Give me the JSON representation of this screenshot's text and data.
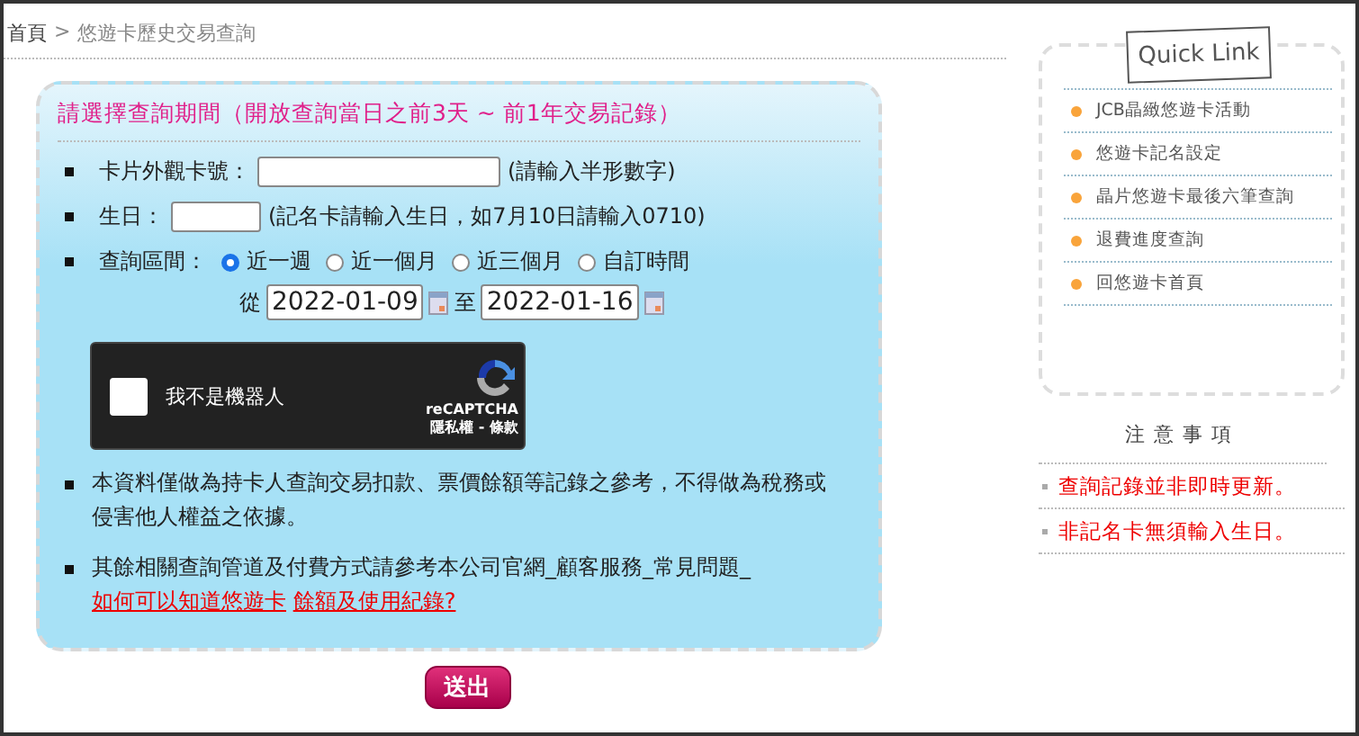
{
  "breadcrumb": {
    "home": "首頁",
    "separator": ">",
    "current": "悠遊卡歷史交易查詢"
  },
  "query_panel": {
    "heading": "請選擇查詢期間（開放查詢當日之前3天 ~ 前1年交易記錄）",
    "card_number": {
      "label": "卡片外觀卡號：",
      "hint": "(請輸入半形數字)"
    },
    "birthday": {
      "label": "生日：",
      "hint": "(記名卡請輸入生日，如7月10日請輸入0710)"
    },
    "period": {
      "label": "查詢區間：",
      "options": [
        {
          "label": "近一週",
          "selected": true
        },
        {
          "label": "近一個月",
          "selected": false
        },
        {
          "label": "近三個月",
          "selected": false
        },
        {
          "label": "自訂時間",
          "selected": false
        }
      ],
      "from_label": "從",
      "from": "2022-01-09",
      "to_label": "至",
      "to": "2022-01-16"
    },
    "captcha": {
      "label": "我不是機器人",
      "checked": false,
      "brand": "reCAPTCHA",
      "links": "隱私權 - 條款"
    },
    "notes": [
      {
        "text": "本資料僅做為持卡人查詢交易扣款、票價餘額等記錄之參考，不得做為稅務或侵害他人權益之依據。"
      },
      {
        "text": "其餘相關查詢管道及付費方式請參考本公司官網_顧客服務_常見問題_",
        "link": [
          "如何可以知道悠遊卡",
          "餘額及使用紀錄?"
        ]
      }
    ]
  },
  "submit": "送出",
  "quick_link": {
    "title": "Quick Link",
    "items": [
      "JCB晶緻悠遊卡活動",
      "悠遊卡記名設定",
      "晶片悠遊卡最後六筆查詢",
      "退費進度查詢",
      "回悠遊卡首頁"
    ]
  },
  "notices": {
    "title": "注意事項",
    "items": [
      "查詢記錄並非即時更新。",
      "非記名卡無須輸入生日。"
    ]
  }
}
